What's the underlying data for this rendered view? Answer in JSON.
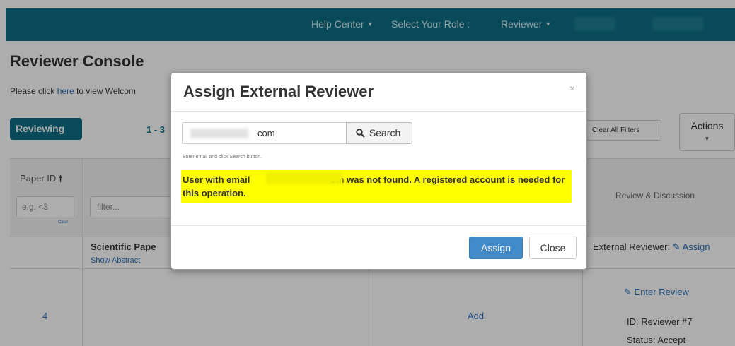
{
  "topnav": {
    "help_center": "Help Center",
    "select_role_label": "Select Your Role :",
    "role_value": "Reviewer"
  },
  "page": {
    "title": "Reviewer Console",
    "intro_prefix": "Please click ",
    "intro_link": "here",
    "intro_suffix": " to view Welcom",
    "tab_reviewing": "Reviewing",
    "pager": "1 - 3",
    "clear_all_filters": "Clear All Filters",
    "actions": "Actions"
  },
  "table": {
    "header_paper_id": "Paper ID",
    "paper_id_filter_placeholder": "e.g. <3",
    "clear_label": "Clear",
    "title_filter_placeholder": "filter...",
    "header_review": "Review & Discussion",
    "row": {
      "paper_id": "4",
      "title": "Scientific Pape",
      "show_abstract": "Show Abstract",
      "add_label": "Add",
      "external_reviewer_label": "External Reviewer:",
      "assign_link": "Assign",
      "enter_review": "Enter Review",
      "reviewer_id": "ID: Reviewer #7",
      "reviewer_status": "Status: Accept"
    }
  },
  "modal": {
    "title": "Assign External Reviewer",
    "close_glyph": "×",
    "email_value": "com",
    "search_label": "Search",
    "help_text": "Enter email and click Search button.",
    "alert_part1": "User with email ",
    "alert_part2": "om was not found. A registered account is needed for this operation.",
    "assign_label": "Assign",
    "close_label": "Close"
  },
  "colors": {
    "nav_bg": "#0d6e83",
    "primary_button": "#428bca",
    "alert_highlight": "#ffff00",
    "link": "#2a6fb7"
  },
  "icons": [
    "caret-down-icon",
    "sort-up-arrow-icon",
    "edit-icon",
    "search-icon",
    "close-icon"
  ]
}
